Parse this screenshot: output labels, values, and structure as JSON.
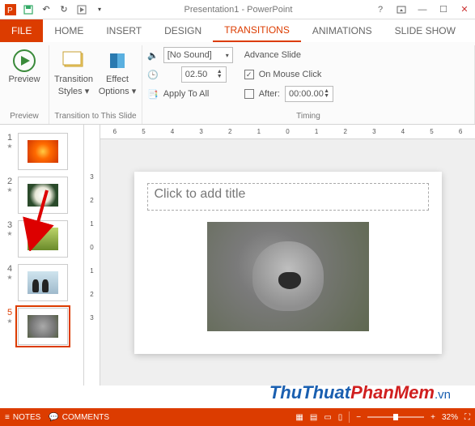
{
  "title": "Presentation1 - PowerPoint",
  "tabs": {
    "file": "FILE",
    "home": "HOME",
    "insert": "INSERT",
    "design": "DESIGN",
    "transitions": "TRANSITIONS",
    "animations": "ANIMATIONS",
    "slideshow": "SLIDE SHOW"
  },
  "ribbon": {
    "preview_btn": "Preview",
    "preview_group": "Preview",
    "styles_btn": "Transition\nStyles",
    "styles_line1": "Transition",
    "styles_line2": "Styles",
    "options_btn": "Effect\nOptions",
    "options_line1": "Effect",
    "options_line2": "Options",
    "transition_group": "Transition to This Slide",
    "sound": "[No Sound]",
    "duration": "02.50",
    "apply_all": "Apply To All",
    "advance_label": "Advance Slide",
    "on_mouse": "On Mouse Click",
    "after": "After:",
    "after_value": "00:00.00",
    "timing_group": "Timing"
  },
  "ruler_h": [
    "6",
    "5",
    "4",
    "3",
    "2",
    "1",
    "0",
    "1",
    "2",
    "3",
    "4",
    "5",
    "6"
  ],
  "ruler_v": [
    "3",
    "2",
    "1",
    "0",
    "1",
    "2",
    "3"
  ],
  "slides": [
    {
      "num": "1"
    },
    {
      "num": "2"
    },
    {
      "num": "3"
    },
    {
      "num": "4"
    },
    {
      "num": "5"
    }
  ],
  "slide_placeholder": "Click to add title",
  "status": {
    "notes": "NOTES",
    "comments": "COMMENTS",
    "zoom": "32%"
  },
  "watermark": {
    "a": "ThuThuat",
    "b": "PhanMem",
    "suf": ".vn"
  }
}
